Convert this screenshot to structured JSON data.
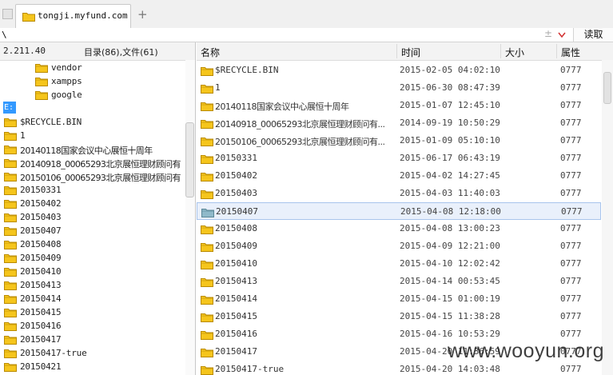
{
  "tab": {
    "title": "tongji.myfund.com",
    "new_tab_label": "+"
  },
  "address": {
    "path": "\\",
    "plus": "±",
    "read_button": "读取"
  },
  "tree": {
    "server_ip": "2.211.40",
    "stats": "目录(86),文件(61)",
    "top_folders": [
      "vendor",
      "xampps",
      "google"
    ],
    "drive": "E:",
    "folders": [
      "$RECYCLE.BIN",
      "1",
      "20140118国家会议中心展恒十周年",
      "20140918_00065293北京展恒理财顾问有",
      "20150106_00065293北京展恒理财顾问有",
      "20150331",
      "20150402",
      "20150403",
      "20150407",
      "20150408",
      "20150409",
      "20150410",
      "20150413",
      "20150414",
      "20150415",
      "20150416",
      "20150417",
      "20150417-true",
      "20150421"
    ]
  },
  "columns": {
    "name": "名称",
    "time": "时间",
    "size": "大小",
    "attr": "属性"
  },
  "files": [
    {
      "name": "$RECYCLE.BIN",
      "time": "2015-02-05 04:02:10",
      "attr": "0777"
    },
    {
      "name": "1",
      "time": "2015-06-30 08:47:39",
      "attr": "0777"
    },
    {
      "name": "20140118国家会议中心展恒十周年",
      "time": "2015-01-07 12:45:10",
      "attr": "0777"
    },
    {
      "name": "20140918_00065293北京展恒理财顾问有...",
      "time": "2014-09-19 10:50:29",
      "attr": "0777"
    },
    {
      "name": "20150106_00065293北京展恒理财顾问有...",
      "time": "2015-01-09 05:10:10",
      "attr": "0777"
    },
    {
      "name": "20150331",
      "time": "2015-06-17 06:43:19",
      "attr": "0777"
    },
    {
      "name": "20150402",
      "time": "2015-04-02 14:27:45",
      "attr": "0777"
    },
    {
      "name": "20150403",
      "time": "2015-04-03 11:40:03",
      "attr": "0777"
    },
    {
      "name": "20150407",
      "time": "2015-04-08 12:18:00",
      "attr": "0777",
      "selected": true
    },
    {
      "name": "20150408",
      "time": "2015-04-08 13:00:23",
      "attr": "0777"
    },
    {
      "name": "20150409",
      "time": "2015-04-09 12:21:00",
      "attr": "0777"
    },
    {
      "name": "20150410",
      "time": "2015-04-10 12:02:42",
      "attr": "0777"
    },
    {
      "name": "20150413",
      "time": "2015-04-14 00:53:45",
      "attr": "0777"
    },
    {
      "name": "20150414",
      "time": "2015-04-15 01:00:19",
      "attr": "0777"
    },
    {
      "name": "20150415",
      "time": "2015-04-15 11:38:28",
      "attr": "0777"
    },
    {
      "name": "20150416",
      "time": "2015-04-16 10:53:29",
      "attr": "0777"
    },
    {
      "name": "20150417",
      "time": "2015-04-20 11:36:59",
      "attr": "0777"
    },
    {
      "name": "20150417-true",
      "time": "2015-04-20 14:03:48",
      "attr": "0777"
    }
  ],
  "watermark": "www.wooyun.org",
  "colors": {
    "folder": "#f5c51c",
    "folder_outline": "#b98a00",
    "selected_folder": "#8fb9c9",
    "drive_bg": "#3399ff"
  }
}
